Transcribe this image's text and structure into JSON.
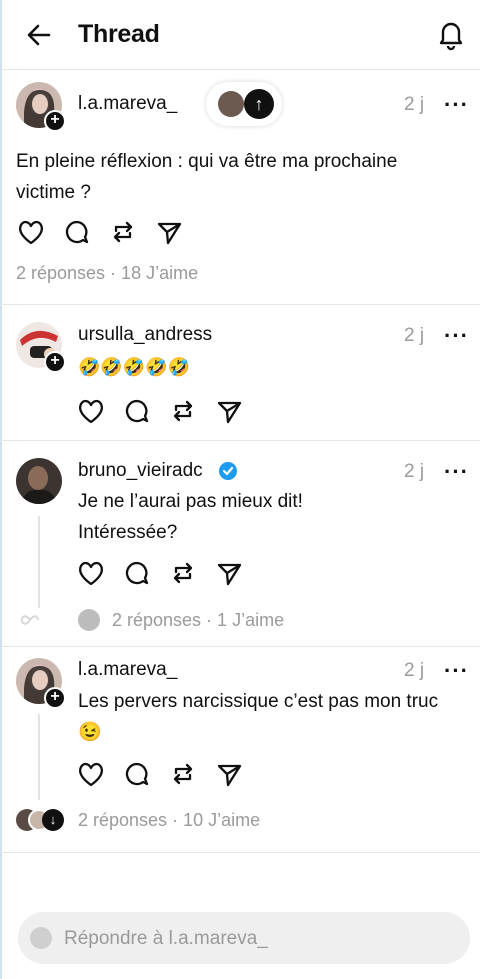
{
  "header": {
    "title": "Thread"
  },
  "post": {
    "username": "l.a.mareva_",
    "time": "2 j",
    "text": "En pleine réflexion : qui va être ma prochaine victime ?",
    "stats": "2 réponses · 18 J’aime"
  },
  "replies": [
    {
      "username": "ursulla_andress",
      "time": "2 j",
      "text": "🤣🤣🤣🤣🤣"
    },
    {
      "username": "bruno_vieiradc",
      "time": "2 j",
      "verified": true,
      "text_line1": "Je ne l’aurai pas mieux dit!",
      "text_line2": "Intéressée?",
      "stats": "2 réponses · 1 J’aime"
    },
    {
      "username": "l.a.mareva_",
      "time": "2 j",
      "text_line1": "Les pervers narcissique c’est pas mon truc",
      "text_line2": "😉",
      "stats": "2 réponses · 10 J’aime"
    }
  ],
  "reply_bar": {
    "placeholder": "Répondre à l.a.mareva_"
  },
  "colors": {
    "verified": "#1d9bf0",
    "muted": "#9a9a9a"
  }
}
